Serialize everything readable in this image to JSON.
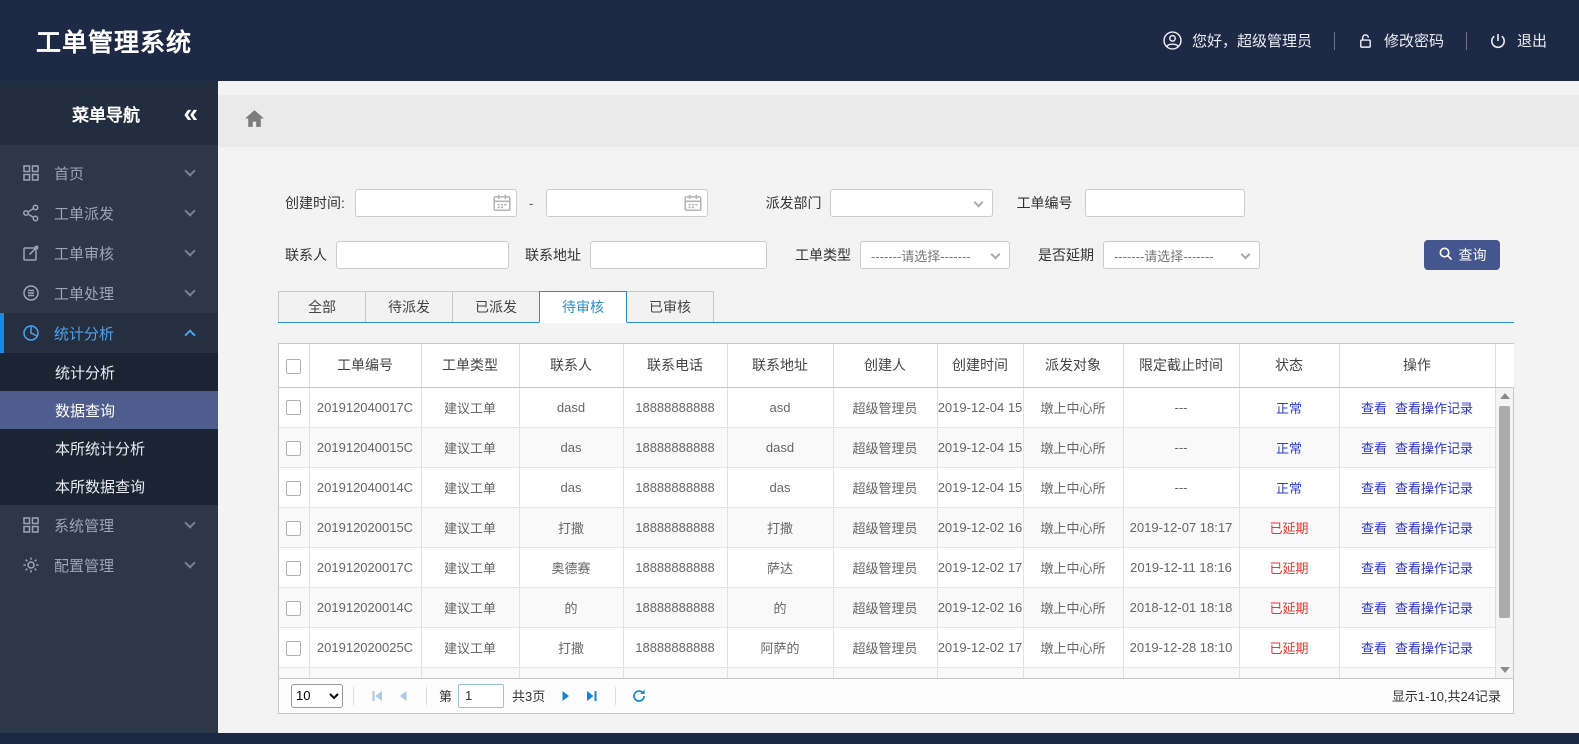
{
  "app": {
    "title": "工单管理系统"
  },
  "topbar": {
    "greeting": "您好，超级管理员",
    "change_password": "修改密码",
    "logout": "退出"
  },
  "sidebar": {
    "title": "菜单导航",
    "collapse_icon": "«",
    "items": [
      {
        "label": "首页",
        "icon": "grid-icon"
      },
      {
        "label": "工单派发",
        "icon": "share-icon"
      },
      {
        "label": "工单审核",
        "icon": "edit-icon"
      },
      {
        "label": "工单处理",
        "icon": "process-icon"
      },
      {
        "label": "统计分析",
        "icon": "pie-icon",
        "expanded": true,
        "children": [
          {
            "label": "统计分析"
          },
          {
            "label": "数据查询",
            "active": true
          },
          {
            "label": "本所统计分析"
          },
          {
            "label": "本所数据查询"
          }
        ]
      },
      {
        "label": "系统管理",
        "icon": "modules-icon"
      },
      {
        "label": "配置管理",
        "icon": "gear-icon"
      }
    ]
  },
  "filters": {
    "create_time": {
      "label": "创建时间:",
      "value_from": "",
      "value_to": "",
      "separator": "-"
    },
    "dispatch_dept": {
      "label": "派发部门",
      "value": ""
    },
    "order_no": {
      "label": "工单编号",
      "value": ""
    },
    "contact": {
      "label": "联系人",
      "value": ""
    },
    "address": {
      "label": "联系地址",
      "value": ""
    },
    "order_type": {
      "label": "工单类型",
      "value": "-------请选择-------"
    },
    "delayed": {
      "label": "是否延期",
      "value": "-------请选择-------"
    },
    "search_button": "查询"
  },
  "tabs": [
    {
      "label": "全部"
    },
    {
      "label": "待派发"
    },
    {
      "label": "已派发"
    },
    {
      "label": "待审核",
      "active": true
    },
    {
      "label": "已审核"
    }
  ],
  "table": {
    "columns": [
      "工单编号",
      "工单类型",
      "联系人",
      "联系电话",
      "联系地址",
      "创建人",
      "创建时间",
      "派发对象",
      "限定截止时间",
      "状态",
      "操作"
    ],
    "action_labels": [
      "查看",
      "查看操作记录"
    ],
    "rows": [
      {
        "order_no": "201912040017C",
        "order_type": "建议工单",
        "contact": "dasd",
        "phone": "18888888888",
        "address": "asd",
        "creator": "超级管理员",
        "created": "2019-12-04 15",
        "dispatch_target": "墩上中心所",
        "deadline": "---",
        "status": "正常",
        "status_type": "normal"
      },
      {
        "order_no": "201912040015C",
        "order_type": "建议工单",
        "contact": "das",
        "phone": "18888888888",
        "address": "dasd",
        "creator": "超级管理员",
        "created": "2019-12-04 15",
        "dispatch_target": "墩上中心所",
        "deadline": "---",
        "status": "正常",
        "status_type": "normal"
      },
      {
        "order_no": "201912040014C",
        "order_type": "建议工单",
        "contact": "das",
        "phone": "18888888888",
        "address": "das",
        "creator": "超级管理员",
        "created": "2019-12-04 15",
        "dispatch_target": "墩上中心所",
        "deadline": "---",
        "status": "正常",
        "status_type": "normal"
      },
      {
        "order_no": "201912020015C",
        "order_type": "建议工单",
        "contact": "打撒",
        "phone": "18888888888",
        "address": "打撒",
        "creator": "超级管理员",
        "created": "2019-12-02 16",
        "dispatch_target": "墩上中心所",
        "deadline": "2019-12-07 18:17",
        "status": "已延期",
        "status_type": "delayed"
      },
      {
        "order_no": "201912020017C",
        "order_type": "建议工单",
        "contact": "奥德赛",
        "phone": "18888888888",
        "address": "萨达",
        "creator": "超级管理员",
        "created": "2019-12-02 17",
        "dispatch_target": "墩上中心所",
        "deadline": "2019-12-11 18:16",
        "status": "已延期",
        "status_type": "delayed"
      },
      {
        "order_no": "201912020014C",
        "order_type": "建议工单",
        "contact": "的",
        "phone": "18888888888",
        "address": "的",
        "creator": "超级管理员",
        "created": "2019-12-02 16",
        "dispatch_target": "墩上中心所",
        "deadline": "2018-12-01 18:18",
        "status": "已延期",
        "status_type": "delayed"
      },
      {
        "order_no": "201912020025C",
        "order_type": "建议工单",
        "contact": "打撒",
        "phone": "18888888888",
        "address": "阿萨的",
        "creator": "超级管理员",
        "created": "2019-12-02 17",
        "dispatch_target": "墩上中心所",
        "deadline": "2019-12-28 18:10",
        "status": "已延期",
        "status_type": "delayed"
      }
    ]
  },
  "pagination": {
    "page_size": "10",
    "page_prefix": "第",
    "current_page": "1",
    "total_pages": "共3页",
    "summary": "显示1-10,共24记录"
  },
  "colors": {
    "header_bg": "#1e2a45",
    "sidebar_bg": "#2c3748",
    "submenu_selected_bg": "#4e5c8e",
    "active_parent_accent": "#1789e8",
    "tab_accent_blue": "#2490d8",
    "link_blue": "#2d33cc",
    "status_normal_blue": "#2b3fd3",
    "status_delayed_red": "#e8352b",
    "search_button_bg": "#44568e"
  }
}
